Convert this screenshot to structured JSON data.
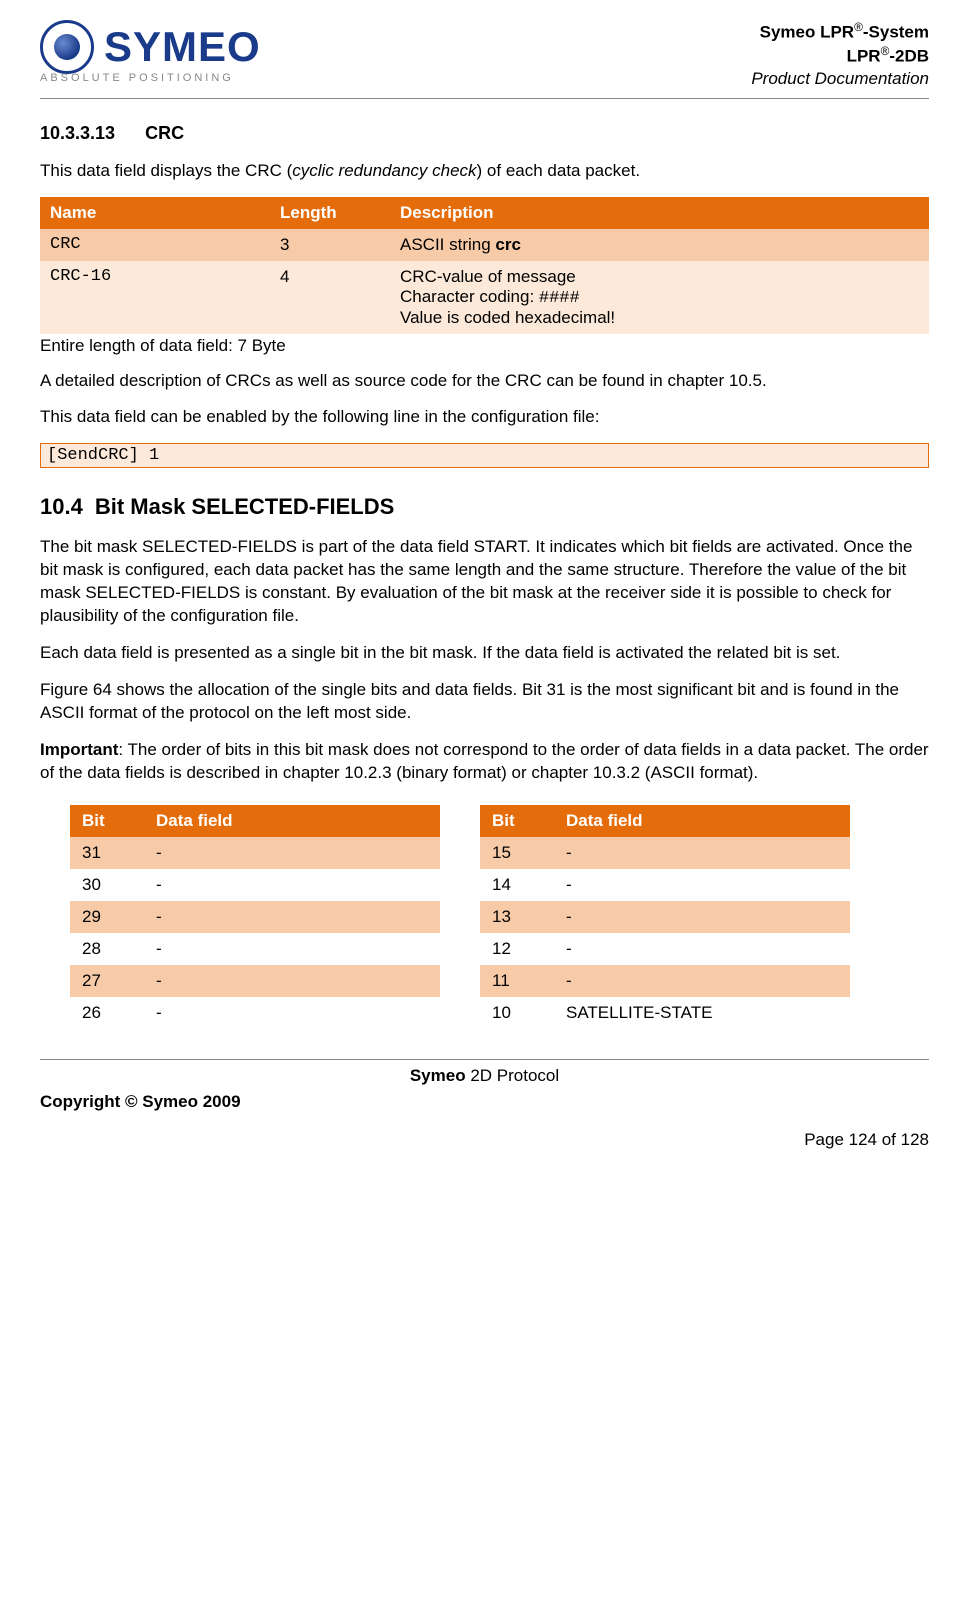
{
  "header": {
    "logo_text": "SYMEO",
    "logo_sub": "ABSOLUTE POSITIONING",
    "line1a": "Symeo LPR",
    "line1b": "-System",
    "line2a": "LPR",
    "line2b": "-2DB",
    "line3": "Product Documentation",
    "sup": "®"
  },
  "section": {
    "num": "10.3.3.13",
    "title": "CRC",
    "intro_a": "This data field displays the CRC (",
    "intro_b": "cyclic redundancy check",
    "intro_c": ") of each data packet."
  },
  "crc_table": {
    "headers": {
      "name": "Name",
      "length": "Length",
      "desc": "Description"
    },
    "rows": [
      {
        "name": "CRC",
        "length": "3",
        "desc_pre": "ASCII string ",
        "desc_bold": "crc"
      },
      {
        "name": "CRC-16",
        "length": "4",
        "desc_l1": "CRC-value of message",
        "desc_l2a": "Character coding:  ",
        "desc_l2b": "####",
        "desc_l3": "Value is coded hexadecimal!"
      }
    ],
    "entire": "Entire length of data field:  7 Byte"
  },
  "after_table": {
    "p1": "A detailed description of CRCs as well as source code for the CRC can be found in chapter 10.5.",
    "p2": "This data field can be enabled by the following line in the configuration file:",
    "config": "[SendCRC]  1"
  },
  "section104": {
    "num": "10.4",
    "title": "Bit Mask SELECTED-FIELDS",
    "p1": "The bit mask SELECTED-FIELDS is part of the data field START. It indicates which bit fields are activated. Once the bit mask is configured, each data packet has the same length and the same structure. Therefore the value of the bit mask SELECTED-FIELDS is constant. By evaluation of the bit mask at the receiver side it is possible to check for plausibility of the configuration file.",
    "p2": "Each data field is presented as a single bit in the bit mask. If the data field is activated the related bit is set.",
    "p3": "Figure 64 shows the allocation of the single bits and data fields. Bit 31 is the most significant bit and is found in the ASCII format of the protocol on the left most side.",
    "p4_bold": "Important",
    "p4_rest": ": The order of bits in this bit mask does not correspond to the order of data fields in a data packet. The order of the data fields is described in chapter 10.2.3 (binary format) or chapter 10.3.2 (ASCII format)."
  },
  "bit_tables": {
    "headers": {
      "bit": "Bit",
      "field": "Data field"
    },
    "left": [
      {
        "bit": "31",
        "field": "-"
      },
      {
        "bit": "30",
        "field": "-"
      },
      {
        "bit": "29",
        "field": "-"
      },
      {
        "bit": "28",
        "field": "-"
      },
      {
        "bit": "27",
        "field": "-"
      },
      {
        "bit": "26",
        "field": "-"
      }
    ],
    "right": [
      {
        "bit": "15",
        "field": "-"
      },
      {
        "bit": "14",
        "field": "-"
      },
      {
        "bit": "13",
        "field": "-"
      },
      {
        "bit": "12",
        "field": "-"
      },
      {
        "bit": "11",
        "field": "-"
      },
      {
        "bit": "10",
        "field": "SATELLITE-STATE"
      }
    ]
  },
  "footer": {
    "center_bold": "Symeo",
    "center_rest": " 2D Protocol",
    "copyright": "Copyright © Symeo 2009",
    "page": "Page 124 of 128"
  }
}
